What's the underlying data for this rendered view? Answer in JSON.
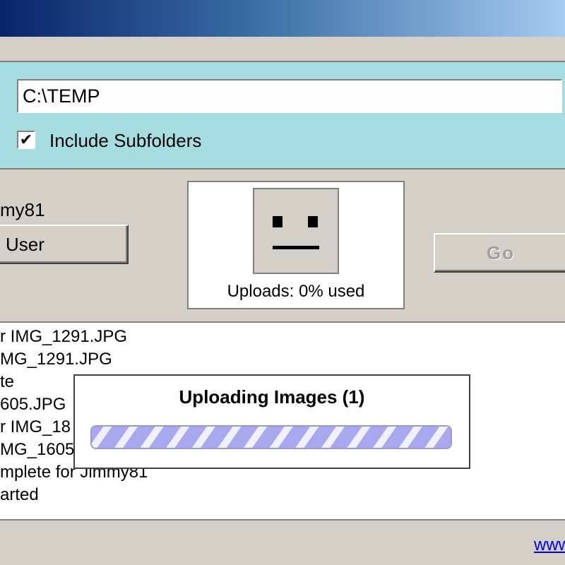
{
  "folder": {
    "path_value": "C:\\TEMP",
    "include_subfolders_label": "Include Subfolders",
    "include_subfolders_checked": true,
    "checkmark": "✔"
  },
  "user": {
    "name": "my81",
    "button_label": "User"
  },
  "status": {
    "uploads_label": "Uploads: 0% used"
  },
  "go_button": {
    "label": "Go",
    "enabled": false
  },
  "log": {
    "lines": [
      "r IMG_1291.JPG",
      "MG_1291.JPG",
      "te",
      "605.JPG",
      "r IMG_18",
      "MG_1605",
      "mplete for Jimmy81",
      "arted"
    ]
  },
  "upload_dialog": {
    "title": "Uploading Images (1)",
    "progress": 1.0
  },
  "footer": {
    "link_text": "www"
  },
  "colors": {
    "panel_background": "#a6dde0",
    "window_face": "#d4d0c8",
    "progress_stripe": "#a8a8ee"
  }
}
